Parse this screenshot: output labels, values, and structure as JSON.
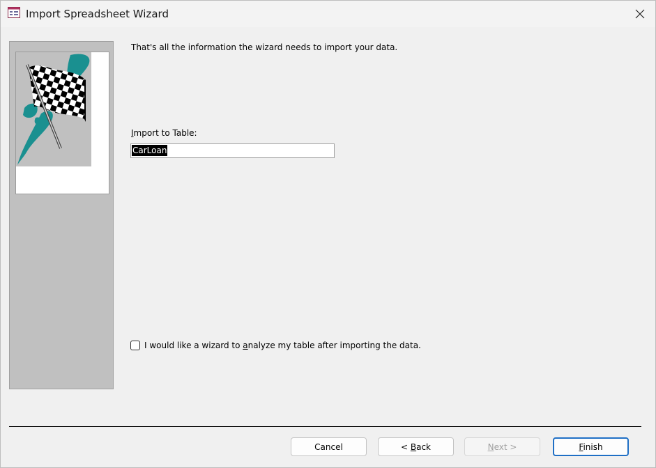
{
  "window": {
    "title": "Import Spreadsheet Wizard",
    "icon": "wizard-app-icon",
    "close_icon": "close-icon"
  },
  "main": {
    "intro": "That's all the information the wizard needs to import your data.",
    "import_label_first": "I",
    "import_label_rest": "mport to Table:",
    "table_name": "CarLoan",
    "checkbox": {
      "checked": false,
      "label_pre": "I would like a wizard to ",
      "label_accel": "a",
      "label_post": "nalyze my table after importing the data."
    }
  },
  "buttons": {
    "cancel": "Cancel",
    "back_pre": "< ",
    "back_accel": "B",
    "back_post": "ack",
    "next_accel": "N",
    "next_post": "ext >",
    "finish_accel": "F",
    "finish_post": "inish"
  },
  "colors": {
    "accent": "#1f6fc5",
    "panel": "#c0c0c0",
    "teal": "#1a9090"
  }
}
